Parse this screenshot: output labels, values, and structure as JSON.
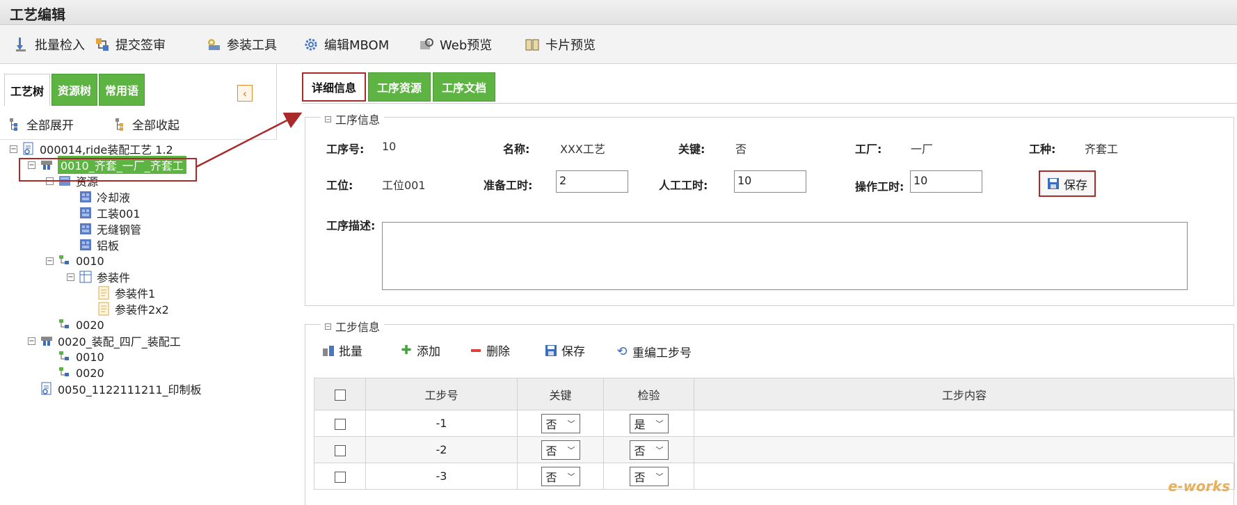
{
  "window": {
    "title": "工艺编辑"
  },
  "toolbar": {
    "items": [
      {
        "label": "批量检入",
        "icon": "check-in-icon"
      },
      {
        "label": "提交签审",
        "icon": "submit-review-icon"
      },
      {
        "label": "参装工具",
        "icon": "assembly-tool-icon"
      },
      {
        "label": "编辑MBOM",
        "icon": "gear-icon"
      },
      {
        "label": "Web预览",
        "icon": "web-preview-icon"
      },
      {
        "label": "卡片预览",
        "icon": "card-preview-icon"
      }
    ]
  },
  "left_panel": {
    "tabs": [
      {
        "label": "工艺树"
      },
      {
        "label": "资源树"
      },
      {
        "label": "常用语"
      }
    ],
    "active_tab": "工艺树",
    "expand_all": "全部展开",
    "collapse_all": "全部收起",
    "tree": [
      {
        "label": "000014,ride装配工艺 1.2",
        "level": 0,
        "toggle": "⊟",
        "icon": "process-doc-icon"
      },
      {
        "label": "0010_齐套_一厂_齐套工",
        "level": 1,
        "toggle": "⊟",
        "icon": "operation-icon",
        "selected": true
      },
      {
        "label": "资源",
        "level": 2,
        "toggle": "⊟",
        "icon": "resource-folder-icon"
      },
      {
        "label": "冷却液",
        "level": 3,
        "icon": "resource-icon"
      },
      {
        "label": "工装001",
        "level": 3,
        "icon": "resource-icon"
      },
      {
        "label": "无缝钢管",
        "level": 3,
        "icon": "resource-icon"
      },
      {
        "label": "铝板",
        "level": 3,
        "icon": "resource-icon"
      },
      {
        "label": "0010",
        "level": 2,
        "toggle": "⊟",
        "icon": "step-icon"
      },
      {
        "label": "参装件",
        "level": 3,
        "toggle": "⊟",
        "icon": "table-icon"
      },
      {
        "label": "参装件1",
        "level": 4,
        "icon": "part-doc-icon"
      },
      {
        "label": "参装件2x2",
        "level": 4,
        "icon": "part-doc-icon"
      },
      {
        "label": "0020",
        "level": 2,
        "icon": "step-icon"
      },
      {
        "label": "0020_装配_四厂_装配工",
        "level": 1,
        "toggle": "⊟",
        "icon": "operation-icon"
      },
      {
        "label": "0010",
        "level": 2,
        "icon": "step-icon"
      },
      {
        "label": "0020",
        "level": 2,
        "icon": "step-icon"
      },
      {
        "label": "0050_1122111211_印制板",
        "level": 1,
        "icon": "process-doc-icon"
      }
    ]
  },
  "right_panel": {
    "tabs": [
      {
        "label": "详细信息"
      },
      {
        "label": "工序资源"
      },
      {
        "label": "工序文档"
      }
    ],
    "active_tab": "详细信息",
    "op_info": {
      "legend": "工序信息",
      "op_no_label": "工序号:",
      "op_no": "10",
      "name_label": "名称:",
      "name": "XXX工艺",
      "key_label": "关键:",
      "key": "否",
      "factory_label": "工厂:",
      "factory": "一厂",
      "trade_label": "工种:",
      "trade": "齐套工",
      "station_label": "工位:",
      "station": "工位001",
      "prep_time_label": "准备工时:",
      "prep_time": "2",
      "labor_time_label": "人工工时:",
      "labor_time": "10",
      "op_time_label": "操作工时:",
      "op_time": "10",
      "save_label": "保存",
      "desc_label": "工序描述:",
      "desc": ""
    },
    "step_info": {
      "legend": "工步信息",
      "toolbar": [
        {
          "label": "批量",
          "icon": "batch-icon"
        },
        {
          "label": "添加",
          "icon": "add-icon"
        },
        {
          "label": "删除",
          "icon": "delete-icon"
        },
        {
          "label": "保存",
          "icon": "save-icon"
        },
        {
          "label": "重编工步号",
          "icon": "renumber-icon"
        }
      ],
      "columns": [
        "",
        "工步号",
        "关键",
        "检验",
        "工步内容"
      ],
      "rows": [
        {
          "step": "-1",
          "key": "否",
          "check": "是",
          "content": ""
        },
        {
          "step": "-2",
          "key": "否",
          "check": "否",
          "content": ""
        },
        {
          "step": "-3",
          "key": "否",
          "check": "否",
          "content": ""
        }
      ]
    }
  },
  "watermark": "e-works",
  "colors": {
    "accent_green": "#5db443",
    "highlight_red": "#a82a2a"
  }
}
